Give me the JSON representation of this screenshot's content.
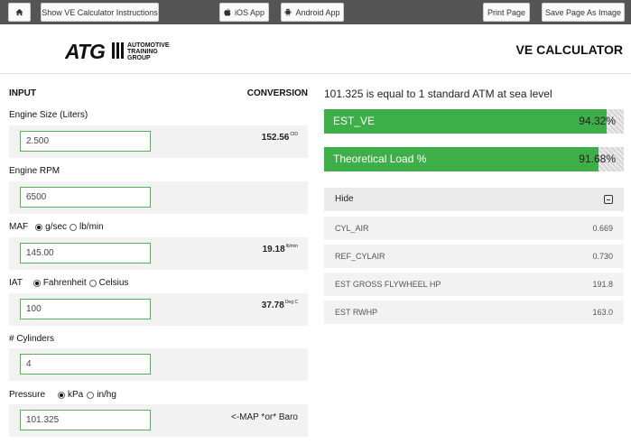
{
  "toolbar": {
    "home_icon": "home-icon",
    "instructions_label": "Show VE Calculator Instructions",
    "ios_label": "iOS App",
    "ios_icon": "apple-icon",
    "android_label": "Android App",
    "android_icon": "android-icon",
    "print_label": "Print Page",
    "save_label": "Save Page As Image"
  },
  "header": {
    "logo_text": "ATG",
    "logo_subtext": [
      "AUTOMOTIVE",
      "TRAINING",
      "GROUP"
    ],
    "title": "VE CALCULATOR"
  },
  "inputs": {
    "input_heading": "INPUT",
    "conversion_heading": "CONVERSION",
    "engine_size": {
      "label": "Engine Size (Liters)",
      "value": "2.500",
      "conversion": "152.56",
      "unit": "CID"
    },
    "engine_rpm": {
      "label": "Engine RPM",
      "value": "6500"
    },
    "maf": {
      "label": "MAF",
      "options": [
        "g/sec",
        "lb/min"
      ],
      "selected": "g/sec",
      "value": "145.00",
      "conversion": "19.18",
      "unit": "lb/min"
    },
    "iat": {
      "label": "IAT",
      "options": [
        "Fahrenheit",
        "Celsius"
      ],
      "selected": "Fahrenheit",
      "value": "100",
      "conversion": "37.78",
      "unit": "Deg C"
    },
    "cylinders": {
      "label": "# Cylinders",
      "value": "4"
    },
    "pressure": {
      "label": "Pressure",
      "options": [
        "kPa",
        "in/hg"
      ],
      "selected": "kPa",
      "value": "101.325",
      "note": "<-MAP *or* Baro"
    }
  },
  "results": {
    "atm_note": "101.325 is equal to 1 standard ATM at sea level",
    "est_ve": {
      "label": "EST_VE",
      "value": "94.32%",
      "fraction": 0.9432
    },
    "theoretical_load": {
      "label": "Theoretical Load %",
      "value": "91.68%",
      "fraction": 0.9168
    },
    "bar_color": "#3eae48",
    "toggle_label": "Hide",
    "stats": [
      {
        "label": "CYL_AIR",
        "value": "0.669"
      },
      {
        "label": "REF_CYLAIR",
        "value": "0.730"
      },
      {
        "label": "EST GROSS FLYWHEEL HP",
        "value": "191.8"
      },
      {
        "label": "EST RWHP",
        "value": "163.0"
      }
    ]
  }
}
